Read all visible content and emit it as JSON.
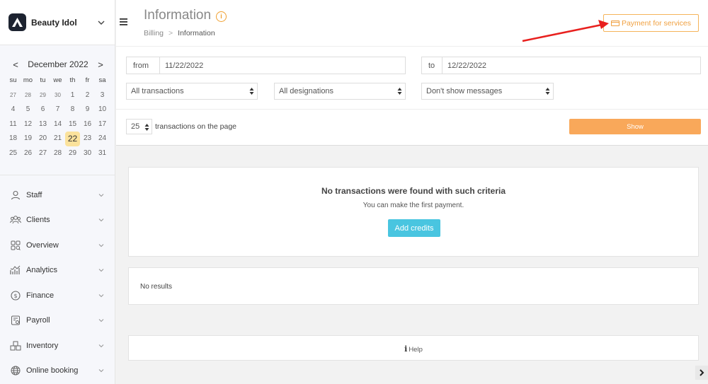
{
  "brand": {
    "name": "Beauty Idol",
    "logo_icon": "logo-icon"
  },
  "calendar": {
    "month_label": "December 2022",
    "prev_label": "<",
    "next_label": ">",
    "weekdays": [
      "su",
      "mo",
      "tu",
      "we",
      "th",
      "fr",
      "sa"
    ],
    "weeks": [
      [
        "27",
        "28",
        "29",
        "30",
        "1",
        "2",
        "3"
      ],
      [
        "4",
        "5",
        "6",
        "7",
        "8",
        "9",
        "10"
      ],
      [
        "11",
        "12",
        "13",
        "14",
        "15",
        "16",
        "17"
      ],
      [
        "18",
        "19",
        "20",
        "21",
        "22",
        "23",
        "24"
      ],
      [
        "25",
        "26",
        "27",
        "28",
        "29",
        "30",
        "31"
      ]
    ],
    "today": "22"
  },
  "menu": [
    {
      "label": "Staff",
      "icon": "user-icon"
    },
    {
      "label": "Clients",
      "icon": "users-icon"
    },
    {
      "label": "Overview",
      "icon": "grid-icon"
    },
    {
      "label": "Analytics",
      "icon": "analytics-icon"
    },
    {
      "label": "Finance",
      "icon": "dollar-icon"
    },
    {
      "label": "Payroll",
      "icon": "payroll-icon"
    },
    {
      "label": "Inventory",
      "icon": "boxes-icon"
    },
    {
      "label": "Online booking",
      "icon": "globe-icon"
    }
  ],
  "header": {
    "title": "Information",
    "info_glyph": "i",
    "breadcrumb": {
      "parent": "Billing",
      "separator": ">",
      "current": "Information"
    },
    "payment_button": "Payment for services"
  },
  "filters": {
    "from_label": "from",
    "from_value": "11/22/2022",
    "to_label": "to",
    "to_value": "12/22/2022",
    "transactions_select": "All transactions",
    "designations_select": "All designations",
    "messages_select": "Don't show messages",
    "per_page_value": "25",
    "per_page_text": "transactions on the page",
    "show_button": "Show"
  },
  "empty_state": {
    "title": "No transactions were found with such criteria",
    "subtitle": "You can make the first payment.",
    "add_button": "Add credits"
  },
  "results": {
    "no_results": "No results"
  },
  "help": {
    "glyph": "i",
    "label": "Help"
  },
  "colors": {
    "accent": "#f9a85a",
    "button_blue": "#49c5e0",
    "today_bg": "#fbe29c",
    "annotation": "#e8201e"
  }
}
